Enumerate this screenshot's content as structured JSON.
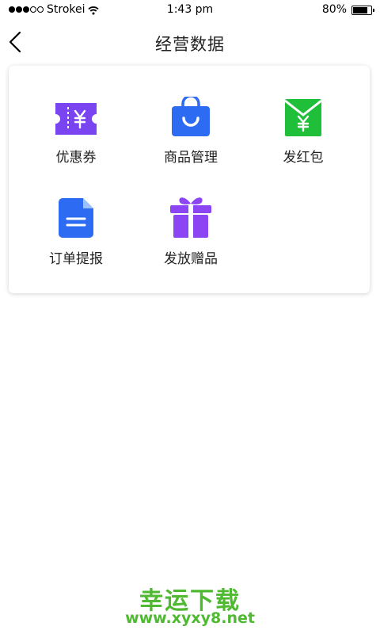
{
  "status_bar": {
    "signal_bars_filled": 3,
    "signal_bars_total": 5,
    "carrier": "Strokei",
    "time": "1:43 pm",
    "battery": "80%",
    "battery_level": 0.8
  },
  "nav": {
    "back_icon": "chevron-left-icon",
    "title": "经营数据"
  },
  "menu": [
    {
      "label": "优惠券",
      "icon": "coupon-icon",
      "color": "#7a45f1"
    },
    {
      "label": "商品管理",
      "icon": "shopping-bag-icon",
      "color": "#2d6cf2"
    },
    {
      "label": "发红包",
      "icon": "red-envelope-icon",
      "color": "#1fbf3a"
    },
    {
      "label": "订单提报",
      "icon": "document-icon",
      "color": "#2d6cf2"
    },
    {
      "label": "发放赠品",
      "icon": "gift-icon",
      "color": "#8b45f3"
    }
  ],
  "watermark": {
    "title": "幸运下载",
    "url": "www.xyxy8.net",
    "color": "#4fb932"
  }
}
